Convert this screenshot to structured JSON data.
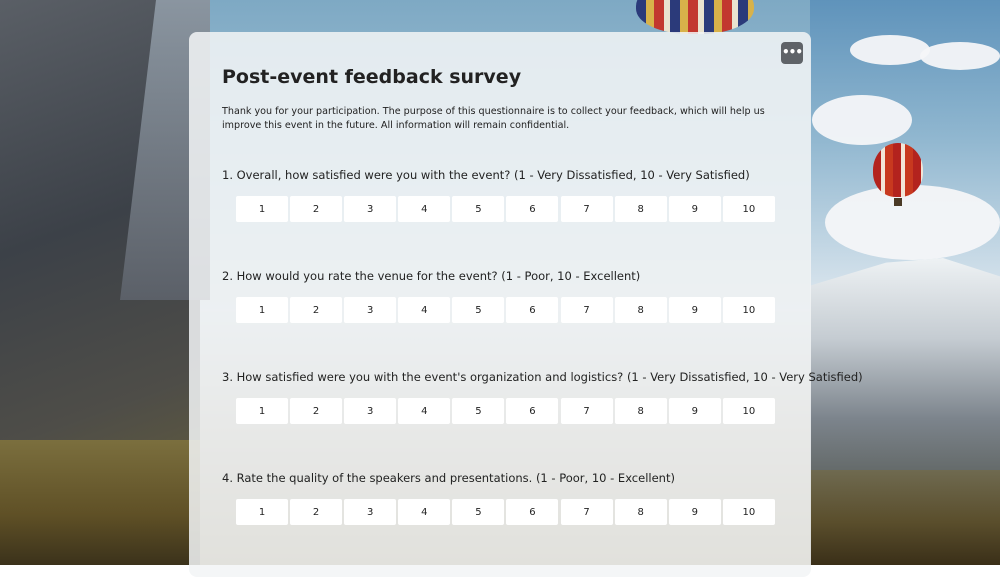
{
  "survey": {
    "title": "Post-event feedback survey",
    "intro": "Thank you for your participation. The purpose of this questionnaire is to collect your feedback, which will help us improve this event in the future. All information will remain confidential.",
    "more_button": "•••"
  },
  "questions": [
    {
      "text": "1. Overall, how satisfied were you with the event? (1 - Very Dissatisfied, 10 - Very Satisfied)",
      "options": [
        "1",
        "2",
        "3",
        "4",
        "5",
        "6",
        "7",
        "8",
        "9",
        "10"
      ]
    },
    {
      "text": "2. How would you rate the venue for the event? (1 - Poor, 10 - Excellent)",
      "options": [
        "1",
        "2",
        "3",
        "4",
        "5",
        "6",
        "7",
        "8",
        "9",
        "10"
      ]
    },
    {
      "text": "3. How satisfied were you with the event's organization and logistics? (1 - Very Dissatisfied, 10 - Very Satisfied)",
      "options": [
        "1",
        "2",
        "3",
        "4",
        "5",
        "6",
        "7",
        "8",
        "9",
        "10"
      ]
    },
    {
      "text": "4. Rate the quality of the speakers and presentations. (1 - Poor, 10 - Excellent)",
      "options": [
        "1",
        "2",
        "3",
        "4",
        "5",
        "6",
        "7",
        "8",
        "9",
        "10"
      ]
    }
  ]
}
